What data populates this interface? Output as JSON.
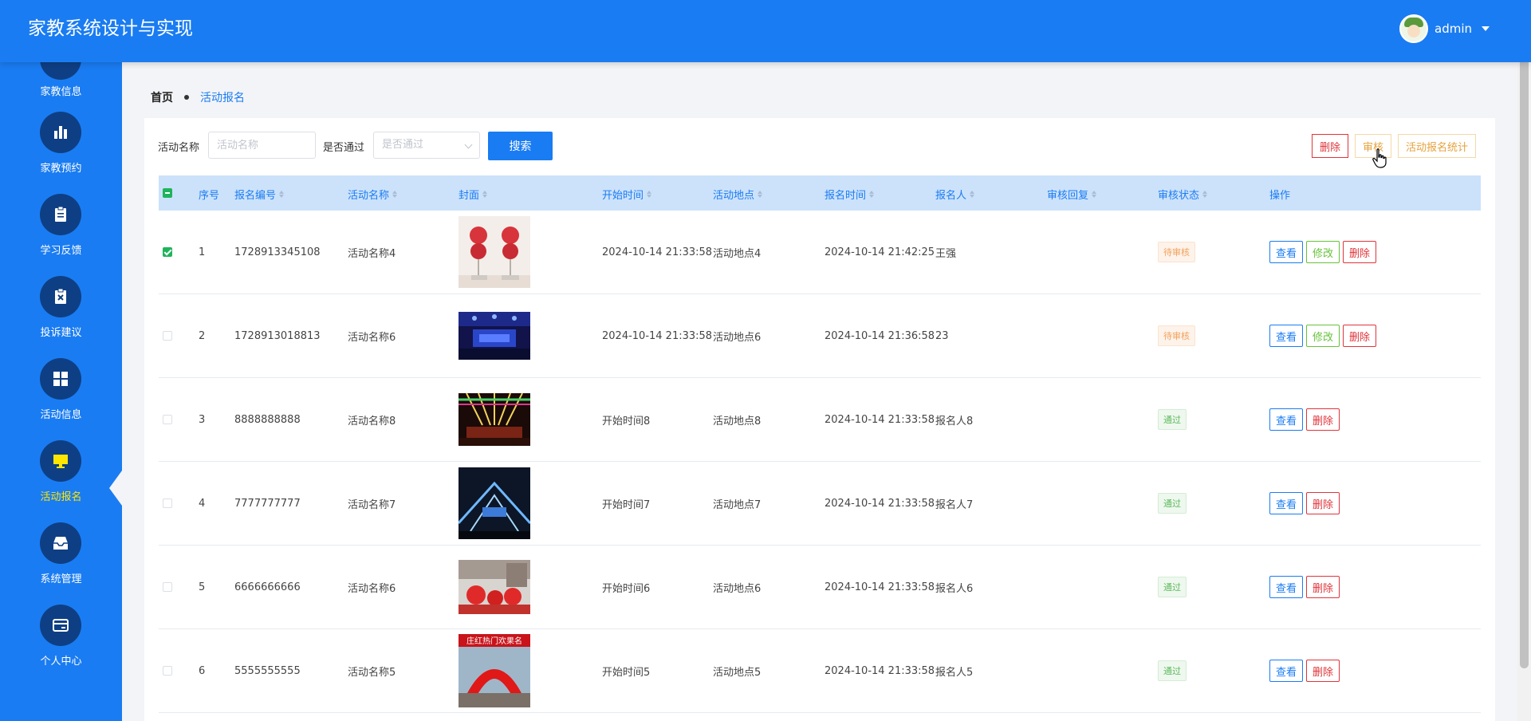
{
  "app": {
    "title": "家教系统设计与实现",
    "username": "admin"
  },
  "sidebar": {
    "items": [
      {
        "label": "家教信息",
        "icon": "list-icon"
      },
      {
        "label": "家教预约",
        "icon": "bar-chart-icon"
      },
      {
        "label": "学习反馈",
        "icon": "clipboard-icon"
      },
      {
        "label": "投诉建议",
        "icon": "clipboard-x-icon"
      },
      {
        "label": "活动信息",
        "icon": "grid-icon"
      },
      {
        "label": "活动报名",
        "icon": "monitor-icon",
        "active": true
      },
      {
        "label": "系统管理",
        "icon": "inbox-icon"
      },
      {
        "label": "个人中心",
        "icon": "card-icon"
      }
    ]
  },
  "breadcrumb": {
    "home": "首页",
    "current": "活动报名"
  },
  "search": {
    "name_label": "活动名称",
    "name_placeholder": "活动名称",
    "pass_label": "是否通过",
    "pass_placeholder": "是否通过",
    "search_button": "搜索"
  },
  "toolbar": {
    "delete": "删除",
    "review": "审核",
    "stats": "活动报名统计"
  },
  "table": {
    "headers": [
      "序号",
      "报名编号",
      "活动名称",
      "封面",
      "开始时间",
      "活动地点",
      "报名时间",
      "报名人",
      "审核回复",
      "审核状态",
      "操作"
    ],
    "actions": {
      "view": "查看",
      "edit": "修改",
      "delete": "删除"
    },
    "rows": [
      {
        "index": "1",
        "code": "1728913345108",
        "name": "活动名称4",
        "start": "2024-10-14 21:33:58",
        "place": "活动地点4",
        "time": "2024-10-14 21:42:25",
        "person": "王强",
        "reply": "",
        "status": "待审核",
        "status_type": "pending",
        "checked": true,
        "editable": true,
        "cover": "balloons"
      },
      {
        "index": "2",
        "code": "1728913018813",
        "name": "活动名称6",
        "start": "2024-10-14 21:33:58",
        "place": "活动地点6",
        "time": "2024-10-14 21:36:58",
        "person": "23",
        "reply": "",
        "status": "待审核",
        "status_type": "pending",
        "checked": false,
        "editable": true,
        "cover": "stage-blue"
      },
      {
        "index": "3",
        "code": "8888888888",
        "name": "活动名称8",
        "start": "开始时间8",
        "place": "活动地点8",
        "time": "2024-10-14 21:33:58",
        "person": "报名人8",
        "reply": "",
        "status": "通过",
        "status_type": "passed",
        "checked": false,
        "editable": false,
        "cover": "stage-lights"
      },
      {
        "index": "4",
        "code": "7777777777",
        "name": "活动名称7",
        "start": "开始时间7",
        "place": "活动地点7",
        "time": "2024-10-14 21:33:58",
        "person": "报名人7",
        "reply": "",
        "status": "通过",
        "status_type": "passed",
        "checked": false,
        "editable": false,
        "cover": "led-hall"
      },
      {
        "index": "5",
        "code": "6666666666",
        "name": "活动名称6",
        "start": "开始时间6",
        "place": "活动地点6",
        "time": "2024-10-14 21:33:58",
        "person": "报名人6",
        "reply": "",
        "status": "通过",
        "status_type": "passed",
        "checked": false,
        "editable": false,
        "cover": "red-balls"
      },
      {
        "index": "6",
        "code": "5555555555",
        "name": "活动名称5",
        "start": "开始时间5",
        "place": "活动地点5",
        "time": "2024-10-14 21:33:58",
        "person": "报名人5",
        "reply": "",
        "status": "通过",
        "status_type": "passed",
        "checked": false,
        "editable": false,
        "cover": "red-arch",
        "cover_text": "庄红热门欢果名"
      }
    ]
  },
  "colors": {
    "primary": "#1a7cf2",
    "sidebar_circle": "#0e3f84",
    "active_label": "#ffe600",
    "danger": "#e0343a",
    "warning": "#e6a23c",
    "success": "#67c23a",
    "header_row": "#cce2fb"
  }
}
